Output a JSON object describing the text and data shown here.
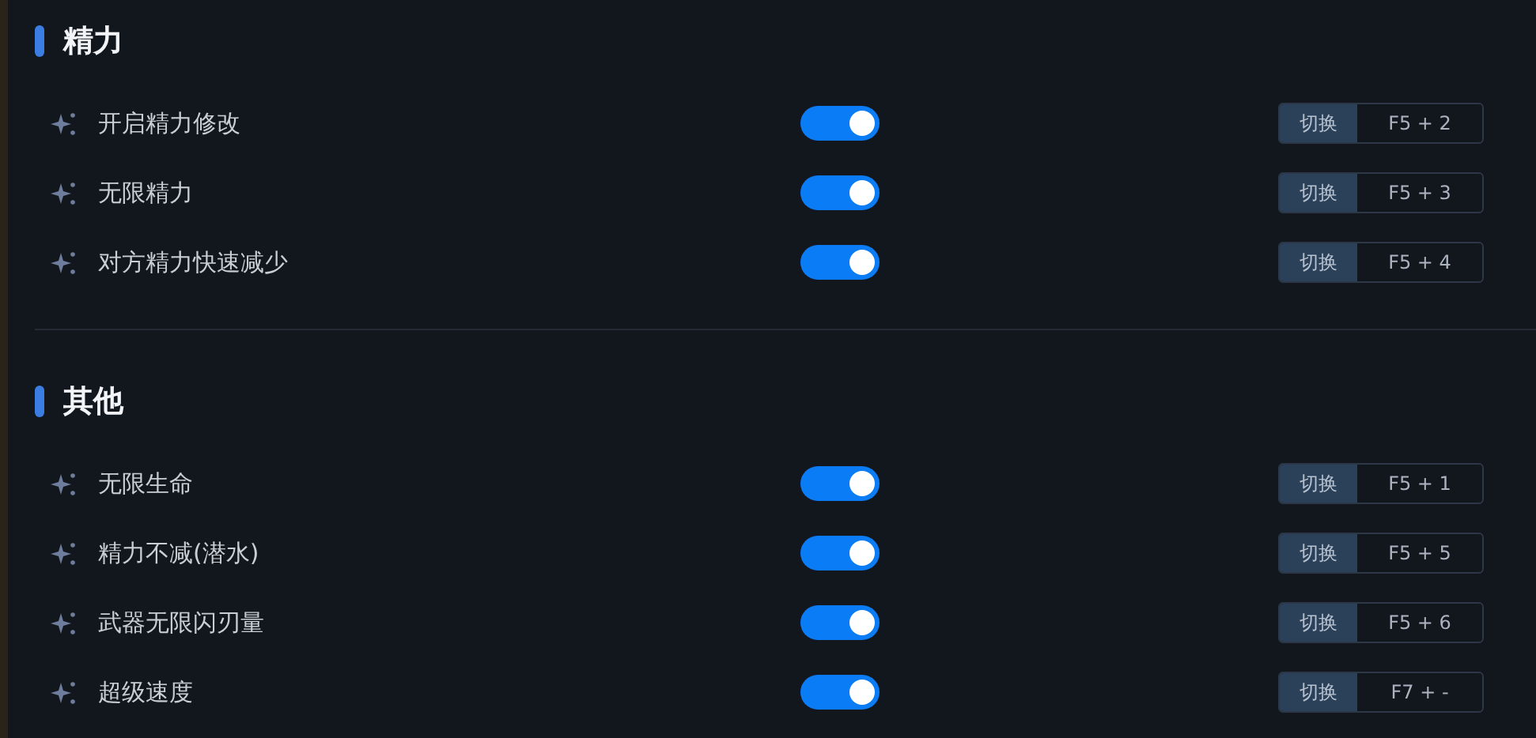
{
  "sections": [
    {
      "title": "精力",
      "items": [
        {
          "name": "开启精力修改",
          "on": true,
          "action": "切换",
          "hotkey": "F5 + 2"
        },
        {
          "name": "无限精力",
          "on": true,
          "action": "切换",
          "hotkey": "F5 + 3"
        },
        {
          "name": "对方精力快速减少",
          "on": true,
          "action": "切换",
          "hotkey": "F5 + 4"
        }
      ]
    },
    {
      "title": "其他",
      "items": [
        {
          "name": "无限生命",
          "on": true,
          "action": "切换",
          "hotkey": "F5 + 1"
        },
        {
          "name": "精力不减(潜水)",
          "on": true,
          "action": "切换",
          "hotkey": "F5 + 5"
        },
        {
          "name": "武器无限闪刃量",
          "on": true,
          "action": "切换",
          "hotkey": "F5 + 6"
        },
        {
          "name": "超级速度",
          "on": true,
          "action": "切换",
          "hotkey": "F7 + -"
        }
      ]
    }
  ]
}
